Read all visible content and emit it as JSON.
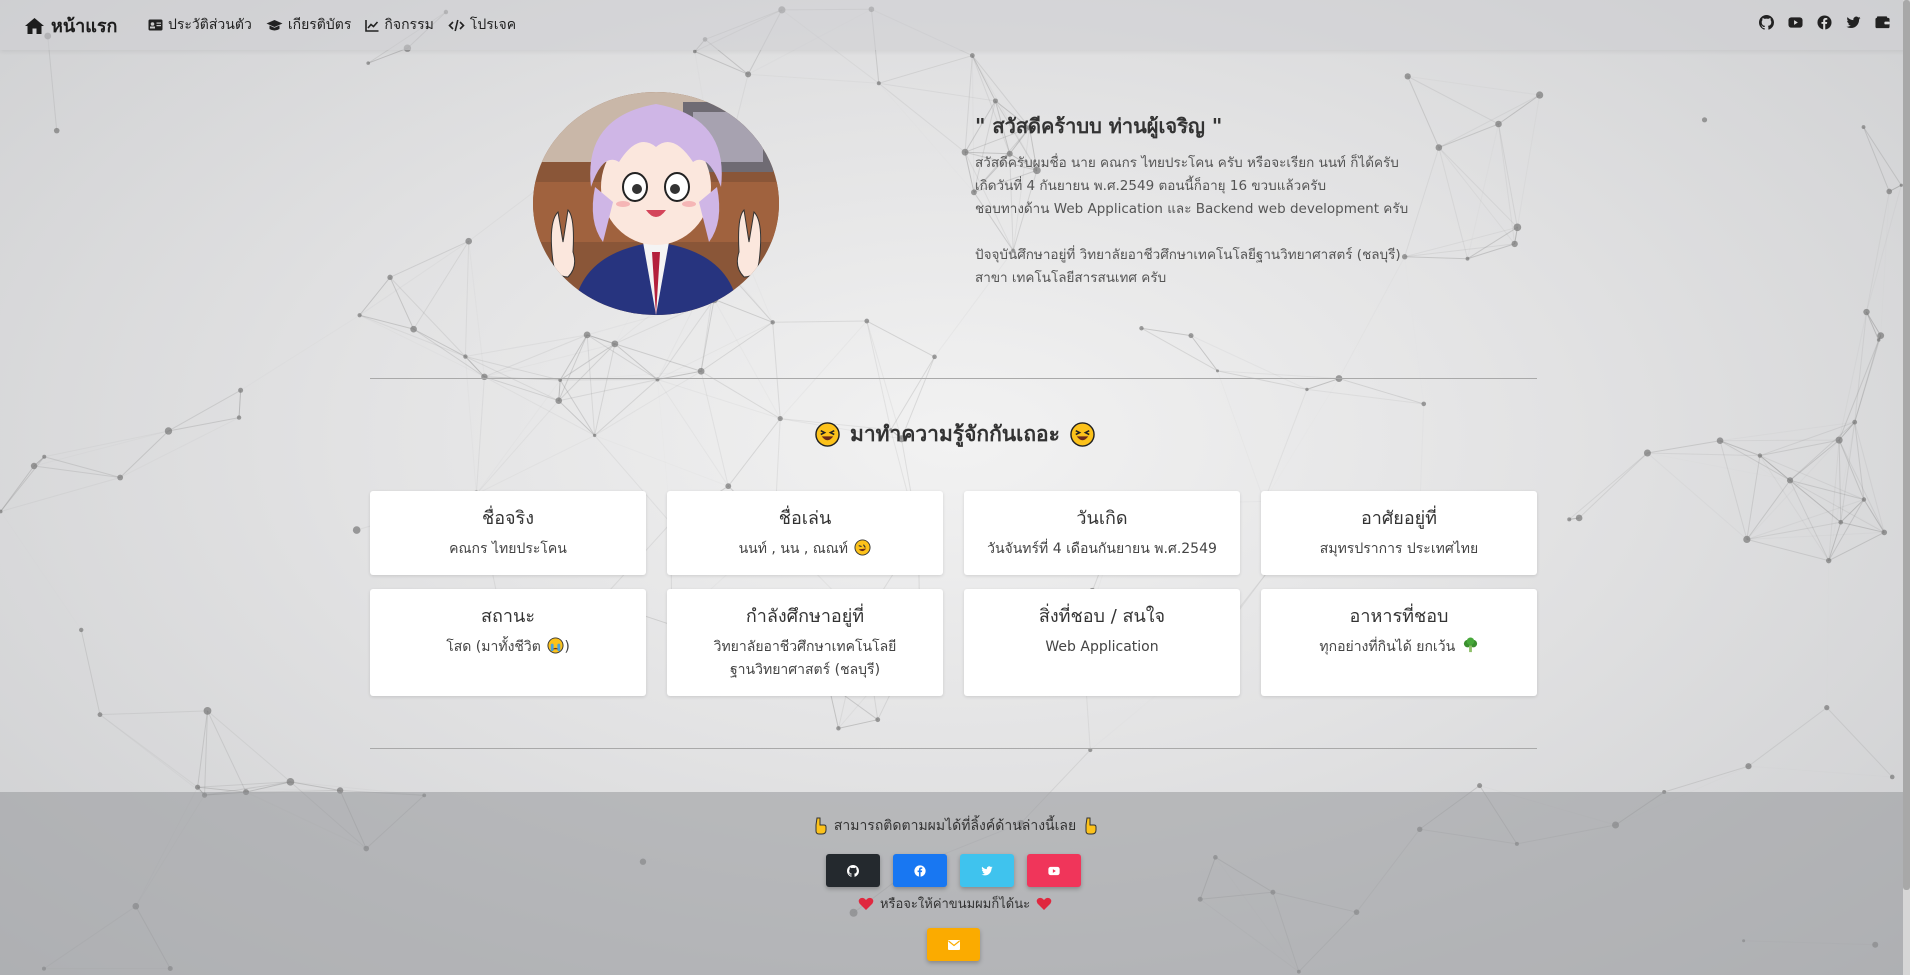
{
  "nav": {
    "brand": "หน้าแรก",
    "links": [
      {
        "label": "ประวัติส่วนตัว",
        "icon": "id-card-icon"
      },
      {
        "label": "เกียรติบัตร",
        "icon": "graduation-cap-icon"
      },
      {
        "label": "กิจกรรม",
        "icon": "line-chart-icon"
      },
      {
        "label": "โปรเจค",
        "icon": "code-icon"
      }
    ],
    "social_icons": [
      "github-icon",
      "youtube-icon",
      "facebook-icon",
      "twitter-icon",
      "wallet-icon"
    ]
  },
  "intro": {
    "greeting": "\" สวัสดีคร้าบบ ท่านผู้เจริญ \"",
    "lines": [
      "สวัสดีครับผมชื่อ นาย คณกร ไทยประโคน ครับ หรือจะเรียก นนท์ ก็ได้ครับ",
      "เกิดวันที่ 4 กันยายน พ.ศ.2549 ตอนนี้ก็อายุ 16 ขวบแล้วครับ",
      "ชอบทางด้าน Web Application และ Backend web development ครับ",
      "ปัจจุบันศึกษาอยู่ที่ วิทยาลัยอาชีวศึกษาเทคโนโลยีฐานวิทยาศาสตร์ (ชลบุรี)",
      "สาขา เทคโนโลยีสารสนเทศ ครับ"
    ]
  },
  "about": {
    "title": "มาทำความรู้จักกันเถอะ",
    "cards": [
      {
        "title": "ชื่อจริง",
        "value": "คณกร ไทยประโคน"
      },
      {
        "title": "ชื่อเล่น",
        "value": "นนท์ , นน , ณณท์"
      },
      {
        "title": "วันเกิด",
        "value": "วันจันทร์ที่ 4 เดือนกันยายน พ.ศ.2549"
      },
      {
        "title": "อาศัยอยู่ที่",
        "value": "สมุทรปราการ ประเทศไทย"
      },
      {
        "title": "สถานะ",
        "value": "โสด (มาทั้งชีวิต",
        "value_end": ")"
      },
      {
        "title": "กำลังศึกษาอยู่ที่",
        "value": "วิทยาลัยอาชีวศึกษาเทคโนโลยี",
        "value2": "ฐานวิทยาศาสตร์ (ชลบุรี)"
      },
      {
        "title": "สิ่งที่ชอบ / สนใจ",
        "value": "Web Application"
      },
      {
        "title": "อาหารที่ชอบ",
        "value": "ทุกอย่างที่กินได้ ยกเว้น"
      }
    ]
  },
  "footer": {
    "follow_text": "สามารถติดตามผมได้ที่ลิ้งค์ด้านล่างนี้เลย",
    "donate_text": "หรือจะให้ค่าขนมผมก็ได้นะ",
    "buttons": [
      {
        "icon": "github-icon",
        "color": "#24292e"
      },
      {
        "icon": "facebook-icon",
        "color": "#1877f2"
      },
      {
        "icon": "twitter-icon",
        "color": "#3fc3ee"
      },
      {
        "icon": "youtube-icon",
        "color": "#f0355a"
      }
    ],
    "donate_color": "#fbab00"
  }
}
